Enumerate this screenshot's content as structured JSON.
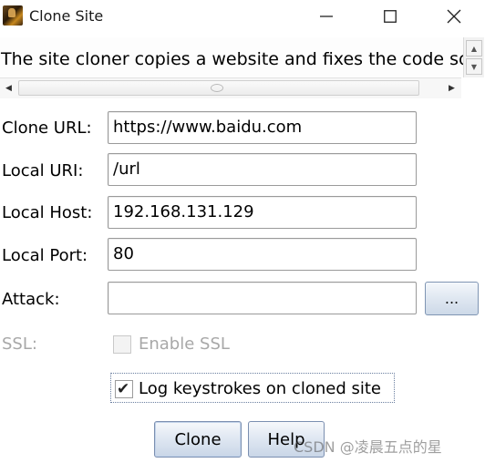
{
  "window": {
    "title": "Clone Site"
  },
  "description": {
    "text": "The site cloner copies a website and fixes the code so"
  },
  "form": {
    "clone_url": {
      "label": "Clone URL:",
      "value": "https://www.baidu.com"
    },
    "local_uri": {
      "label": "Local URI:",
      "value": "/url"
    },
    "local_host": {
      "label": "Local Host:",
      "value": "192.168.131.129"
    },
    "local_port": {
      "label": "Local Port:",
      "value": "80"
    },
    "attack": {
      "label": "Attack:",
      "value": "",
      "browse_label": "..."
    },
    "ssl": {
      "label": "SSL:",
      "checkbox_label": "Enable SSL",
      "checked": false,
      "enabled": false
    },
    "log_keystrokes": {
      "checkbox_label": "Log keystrokes on cloned site",
      "checked": true
    }
  },
  "buttons": {
    "clone": "Clone",
    "help": "Help"
  },
  "watermark": {
    "text": "CSDN @凌晨五点的星"
  },
  "icons": {
    "app": "app-icon",
    "minimize": "minimize-icon",
    "maximize": "maximize-icon",
    "close": "close-icon",
    "scroll_up": "arrow-up-icon",
    "scroll_down": "arrow-down-icon",
    "scroll_left": "arrow-left-icon",
    "scroll_right": "arrow-right-icon",
    "check": "checkmark-icon"
  }
}
